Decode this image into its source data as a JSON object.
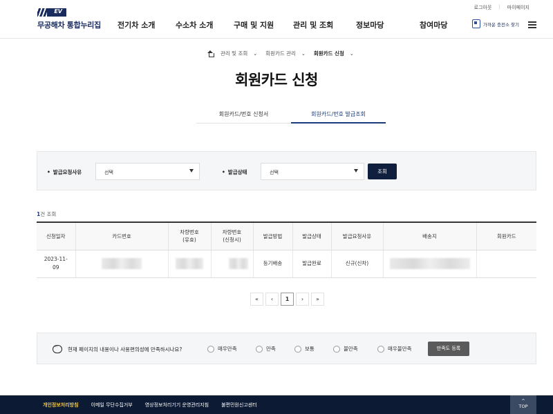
{
  "util": {
    "logout": "로그아웃",
    "mypage": "마이페이지"
  },
  "logo": {
    "badge": "EV",
    "title": "무공해차 통합누리집"
  },
  "gnb": [
    "전기차 소개",
    "수소차 소개",
    "구매 및 지원",
    "관리 및 조회",
    "정보마당",
    "참여마당"
  ],
  "charger_link": "가까운 충전소 찾기",
  "breadcrumb": [
    "관리 및 조회",
    "회원카드 관리",
    "회원카드 신청"
  ],
  "page_title": "회원카드 신청",
  "tabs": [
    {
      "label": "회원카드/번호 신청서",
      "active": false
    },
    {
      "label": "회원카드/번호 발급조회",
      "active": true
    }
  ],
  "search": {
    "reason_label": "발급요청사유",
    "reason_value": "선택",
    "status_label": "발급상태",
    "status_value": "선택",
    "button": "조회"
  },
  "result_count": {
    "number": "1",
    "suffix": "건 조회"
  },
  "table": {
    "headers": [
      "신청일자",
      "카드번호",
      "차량번호\n(유효)",
      "차량번호\n(신청시)",
      "발급방법",
      "발급상태",
      "발급요청사유",
      "배송지",
      "회원카드"
    ],
    "rows": [
      {
        "date": "2023-11-\n09",
        "method": "등기배송",
        "status": "발급완료",
        "reason": "신규(신차)"
      }
    ]
  },
  "pagination": {
    "first": "«",
    "prev": "‹",
    "current": "1",
    "next": "›",
    "last": "»"
  },
  "survey": {
    "question": "현재 페이지의 내용이나 사용편의성에 만족하시나요?",
    "options": [
      "매우만족",
      "만족",
      "보통",
      "불만족",
      "매우불만족"
    ],
    "button": "만족도 등록"
  },
  "footer": {
    "links": [
      "개인정보처리방침",
      "이메일 무단수집거부",
      "영상정보처리기기 운영관리지침",
      "불편민원신고센터"
    ],
    "top": "TOP"
  }
}
